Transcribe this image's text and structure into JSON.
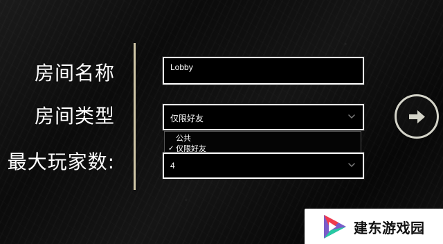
{
  "form": {
    "room_name_label": "房间名称",
    "room_type_label": "房间类型",
    "max_players_label": "最大玩家数:",
    "room_name_value": "Lobby",
    "room_type_value": "仅限好友",
    "max_players_value": "4"
  },
  "room_type_dropdown": {
    "options": [
      {
        "label": "公共",
        "selected": false
      },
      {
        "label": "仅限好友",
        "selected": true
      }
    ],
    "check_glyph": "✓"
  },
  "icons": {
    "select_chevron": "chevron-down-icon",
    "next": "arrow-right-icon",
    "watermark_logo": "play-triangle-logo"
  },
  "watermark": {
    "text": "建东游戏园"
  },
  "colors": {
    "background": "#0c0c0c",
    "field_border": "#ffffff",
    "divider": "#cfc6a7",
    "next_button": "#d4d4c9",
    "logo_red": "#f03b4d",
    "logo_green": "#27c9a2",
    "logo_purple": "#7b5cc9"
  }
}
